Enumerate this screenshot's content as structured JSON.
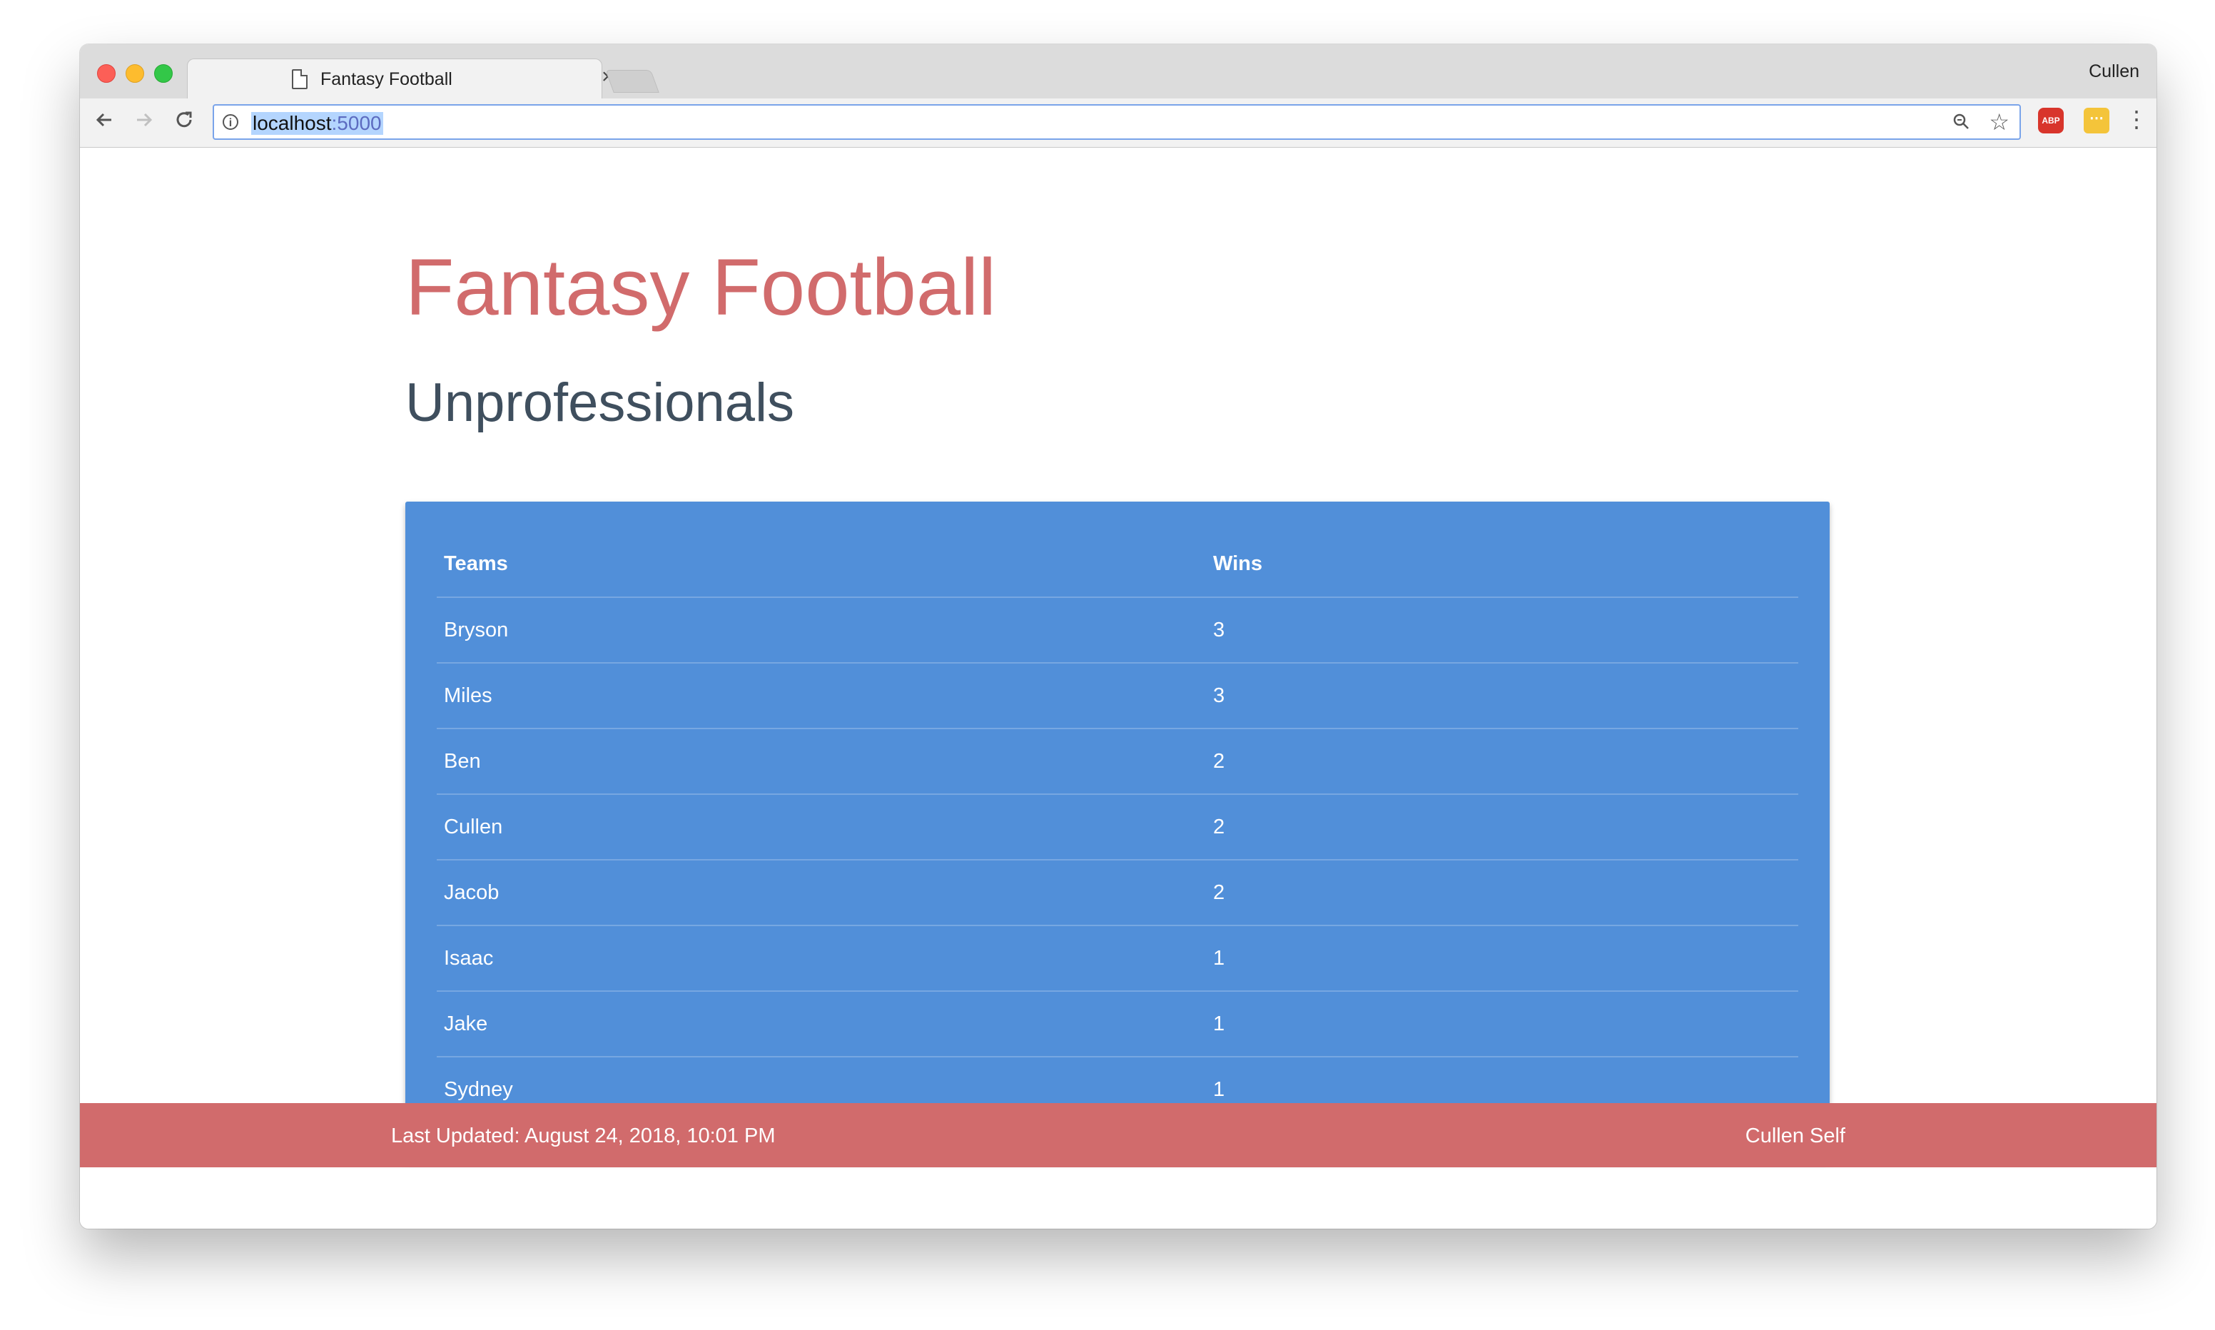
{
  "browser": {
    "tab_title": "Fantasy Football",
    "tab_close": "×",
    "profile_name": "Cullen",
    "url_host": "localhost",
    "url_port": ":5000",
    "ext_abp_label": "ABP"
  },
  "page": {
    "title": "Fantasy Football",
    "league": "Unprofessionals",
    "table": {
      "headers": [
        "Teams",
        "Wins"
      ],
      "rows": [
        {
          "team": "Bryson",
          "wins": "3"
        },
        {
          "team": "Miles",
          "wins": "3"
        },
        {
          "team": "Ben",
          "wins": "2"
        },
        {
          "team": "Cullen",
          "wins": "2"
        },
        {
          "team": "Jacob",
          "wins": "2"
        },
        {
          "team": "Isaac",
          "wins": "1"
        },
        {
          "team": "Jake",
          "wins": "1"
        },
        {
          "team": "Sydney",
          "wins": "1"
        }
      ]
    }
  },
  "footer": {
    "last_updated": "Last Updated: August 24, 2018, 10:01 PM",
    "author": "Cullen Self"
  },
  "colors": {
    "accent": "#d16b6c",
    "table_bg": "#518fd9",
    "subtitle": "#3f4f5e"
  }
}
